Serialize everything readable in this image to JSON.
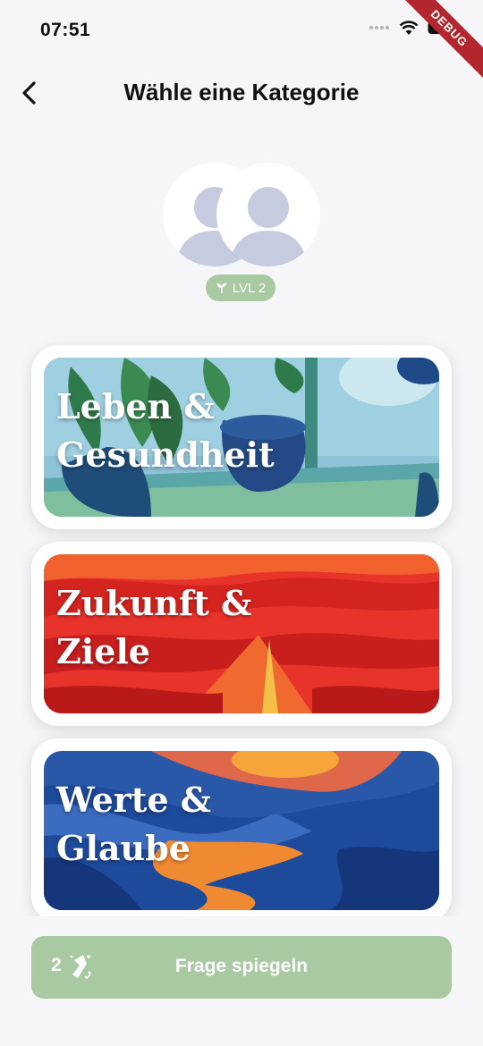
{
  "status_bar": {
    "time": "07:51",
    "debug_label": "DEBUG",
    "icons": [
      "signal-dots-icon",
      "wifi-icon",
      "battery-icon"
    ]
  },
  "header": {
    "title": "Wähle eine Kategorie",
    "back_icon": "chevron-left-icon"
  },
  "players": {
    "level_badge": "LVL 2",
    "badge_icon": "sprout-icon"
  },
  "categories": [
    {
      "label": "Leben &\nGesundheit",
      "theme": "blue-plants"
    },
    {
      "label": "Zukunft &\nZiele",
      "theme": "red-road"
    },
    {
      "label": "Werte &\nGlaube",
      "theme": "blue-river"
    }
  ],
  "cta": {
    "count": "2",
    "icon": "mirror-sparkle-icon",
    "label": "Frage spiegeln"
  },
  "colors": {
    "background": "#f6f6f8",
    "accent": "#a8c9a1",
    "avatar_placeholder": "#c7cbe0"
  }
}
